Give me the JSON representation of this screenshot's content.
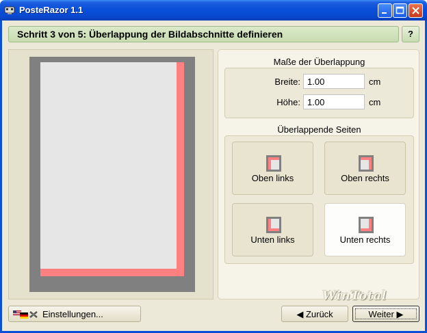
{
  "window": {
    "title": "PosteRazor 1.1",
    "icons": {
      "app": "posterazor-app-icon",
      "minimize": "minimize-icon",
      "maximize": "maximize-icon",
      "close": "close-icon"
    }
  },
  "step": {
    "title": "Schritt 3 von 5: Überlappung der Bildabschnitte definieren",
    "help_label": "?"
  },
  "overlap_size": {
    "title": "Maße der Überlappung",
    "width_label": "Breite:",
    "width_value": "1.00",
    "width_unit": "cm",
    "height_label": "Höhe:",
    "height_value": "1.00",
    "height_unit": "cm"
  },
  "overlap_pages": {
    "title": "Überlappende Seiten",
    "options": [
      {
        "label": "Oben links",
        "selected": false
      },
      {
        "label": "Oben rechts",
        "selected": false
      },
      {
        "label": "Unten links",
        "selected": false
      },
      {
        "label": "Unten rechts",
        "selected": true
      }
    ]
  },
  "buttons": {
    "settings_label": "Einstellungen...",
    "back_label": "◀ Zurück",
    "next_label": "Weiter ▶"
  },
  "watermark": "WinTotal",
  "colors": {
    "titlebar": "#0a4fd8",
    "overlap": "#ff8080",
    "sheet_border": "#808080",
    "sheet": "#e6e6e6",
    "header_bg": "#c7dcb1"
  }
}
